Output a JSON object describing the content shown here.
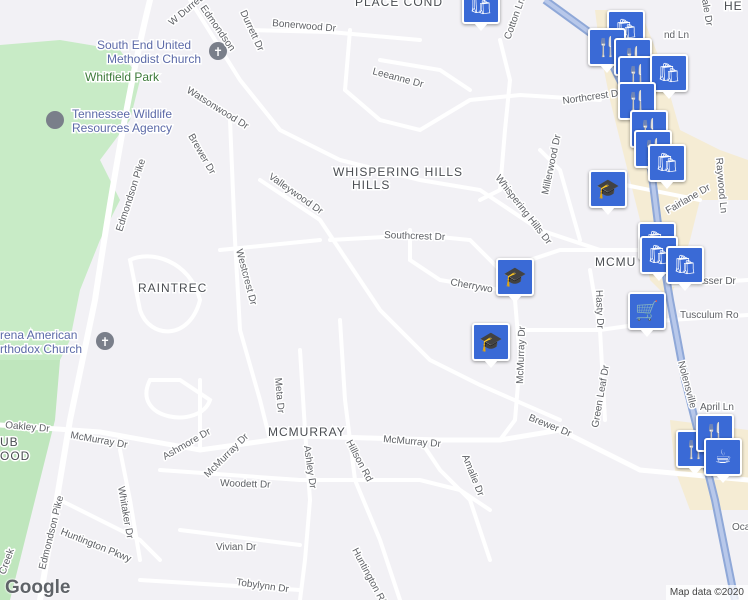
{
  "map": {
    "neighborhoods": [
      "WHISPERING HILLS",
      "RAINTREC",
      "MCMURRAY",
      "MCMU COUR",
      "PLACE COND",
      "HE"
    ],
    "points_of_interest": [
      "South End United Methodist Church",
      "Whitfield Park",
      "Tennessee Wildlife Resources Agency",
      "Serbian American Orthodox Church"
    ],
    "poi_lines": {
      "church1_l1": "South End United",
      "church1_l2": "Methodist Church",
      "park": "Whitfield Park",
      "twra_l1": "Tennessee Wildlife",
      "twra_l2": "Resources Agency",
      "church2_l1": "rena American",
      "church2_l2": "rthodox Church"
    },
    "streets": {
      "w_durrett": "W Durrett Dr",
      "durrett": "Durrett Dr",
      "edmondson_top": "Edmondson",
      "bonerwood": "Bonerwood Dr",
      "cotton": "Cotton Ln",
      "leeanne": "Leeanne Dr",
      "northcrest": "Northcrest D",
      "watsonwood": "Watsonwood Dr",
      "brewer_n": "Brewer Dr",
      "edmondson_pike": "Edmondson Pike",
      "millerwood": "Millerwood Dr",
      "whispering_hills": "Whispering Hills Dr",
      "valleywood": "Valleywood Dr",
      "southcrest": "Southcrest Dr",
      "fairlane": "Fairlane Dr",
      "raywood": "Raywood Ln",
      "westcrest": "Westcrest Dr",
      "cherrywood": "Cherrywo",
      "hasty": "Hasty Dr",
      "strasser": "trasser Dr",
      "tusculum": "Tusculum Ro",
      "mcmurray_v": "McMurray Dr",
      "meta": "Meta Dr",
      "nolensville": "Nolensville",
      "april": "April Ln",
      "oakley": "Oakley Dr",
      "green_leaf": "Green Leaf Dr",
      "brewer_s": "Brewer Dr",
      "mcmurray_h": "McMurray Dr",
      "mcmurray_h2": "McMurray Dr",
      "ashmore": "Ashmore Dr",
      "ashley": "Ashley Dr",
      "hillson": "Hillson Rd",
      "amalie": "Amalie Dr",
      "woodett": "Woodett Dr",
      "whitaker": "Whitaker Dr",
      "huntington_pkwy": "Huntington Pkwy",
      "vivian": "Vivian Dr",
      "huntington_rd": "Huntington Rid",
      "tobylynn": "Tobylynn Dr",
      "edmondson_pike_s": "Edmondson Pike",
      "ocal": "Oca",
      "nd_ln": "nd Ln",
      "ale": "ale Dr",
      "club": "UB",
      "club2": "OOD",
      "creek": "Creek"
    },
    "pins": [
      {
        "type": "shopping",
        "icon": "shopping-bag-icon"
      },
      {
        "type": "restaurant",
        "icon": "fork-knife-icon"
      },
      {
        "type": "school",
        "icon": "graduation-cap-icon"
      },
      {
        "type": "grocery",
        "icon": "shopping-cart-icon"
      },
      {
        "type": "cafe",
        "icon": "coffee-cup-icon"
      }
    ],
    "colors": {
      "background": "#f2f1f5",
      "road": "#ffffff",
      "highway": "#8fa8d8",
      "park": "#c8ebc6",
      "pin": "#3a6ad6",
      "commercial": "#f5ecd4"
    }
  },
  "footer": {
    "logo": "Google",
    "credit": "Map data ©2020"
  }
}
